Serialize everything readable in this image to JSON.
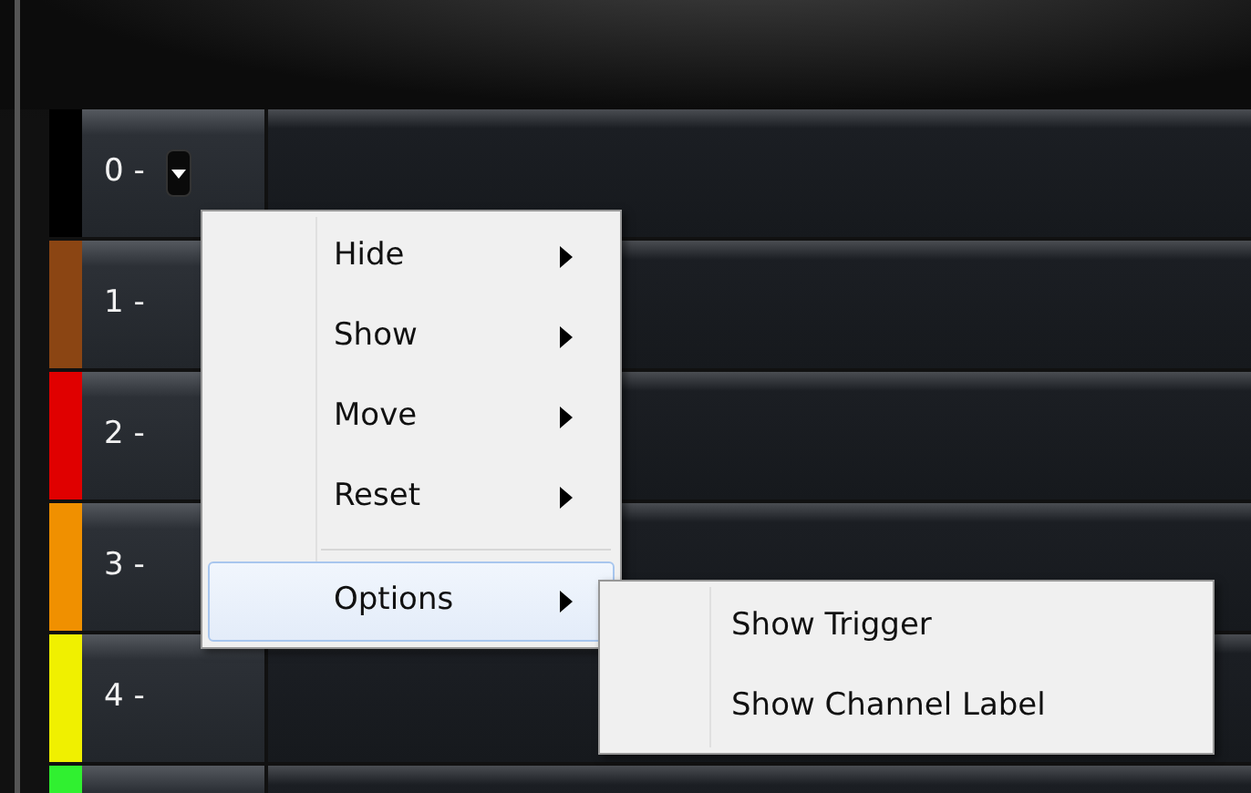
{
  "channels": [
    {
      "label": "0 -",
      "color": "#000000"
    },
    {
      "label": "1 -",
      "color": "#8b4513"
    },
    {
      "label": "2 -",
      "color": "#e00000"
    },
    {
      "label": "3 -",
      "color": "#f09000"
    },
    {
      "label": "4 -",
      "color": "#f0f000"
    },
    {
      "color": "#30f030"
    }
  ],
  "context_menu": {
    "items": [
      {
        "label": "Hide",
        "kind": "submenu",
        "selected": false
      },
      {
        "label": "Show",
        "kind": "submenu",
        "selected": false
      },
      {
        "label": "Move",
        "kind": "submenu",
        "selected": false
      },
      {
        "label": "Reset",
        "kind": "submenu",
        "selected": false
      },
      {
        "kind": "separator"
      },
      {
        "label": "Options",
        "kind": "submenu",
        "selected": true
      }
    ]
  },
  "submenu": {
    "items": [
      {
        "label": "Show Trigger",
        "selected": false
      },
      {
        "label": "Show Channel Label",
        "selected": false
      }
    ]
  }
}
